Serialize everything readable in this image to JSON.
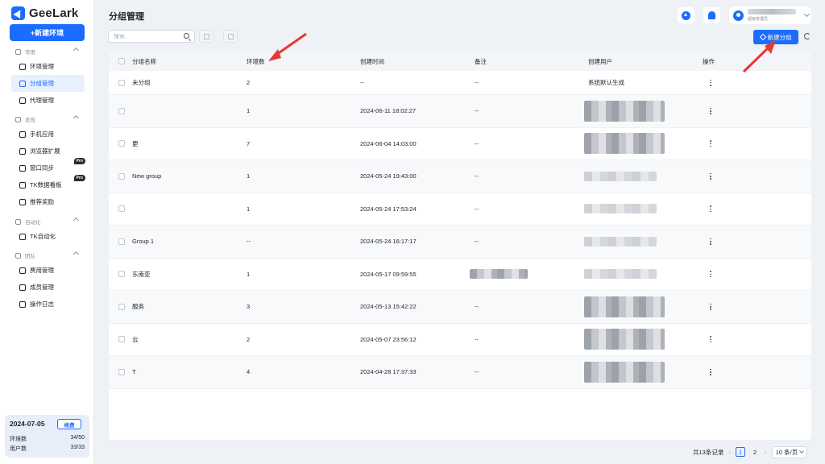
{
  "app": {
    "brand": "GeeLark"
  },
  "sidebar": {
    "new_env_label": "+新建环境",
    "groups": [
      {
        "label": "常用",
        "items": [
          "环境管理",
          "分组管理",
          "代理管理"
        ]
      },
      {
        "label": "发现",
        "items": [
          "手机应用",
          "浏览器扩展",
          "窗口同步",
          "TK数据看板",
          "推荐奖励"
        ]
      },
      {
        "label": "自动化",
        "items": [
          "TK自动化"
        ]
      },
      {
        "label": "团队",
        "items": [
          "费用管理",
          "成员管理",
          "操作日志"
        ]
      }
    ],
    "active_item": "分组管理",
    "pro_badge": "Pro",
    "stats": {
      "date": "2024-07-05",
      "renew_label": "续费",
      "env_label": "环境数",
      "env_value": "34/50",
      "user_label": "用户数",
      "user_value": "33/33"
    }
  },
  "header": {
    "title": "分组管理",
    "user_role": "超级管理员"
  },
  "toolbar": {
    "search_placeholder": "搜索",
    "new_group_label": "新建分组"
  },
  "table": {
    "columns": [
      "分组名称",
      "环境数",
      "创建时间",
      "备注",
      "创建用户",
      "操作"
    ],
    "rows": [
      {
        "name": "未分组",
        "count": "2",
        "created": "--",
        "note": "--",
        "user": "系统默认生成"
      },
      {
        "name": "​",
        "count": "1",
        "created": "2024-06-11 18:02:27",
        "note": "--",
        "user": ""
      },
      {
        "name": "更",
        "count": "7",
        "created": "2024-06-04 14:03:00",
        "note": "--",
        "user": ""
      },
      {
        "name": "New group",
        "count": "1",
        "created": "2024-05-24 19:43:00",
        "note": "--",
        "user": ""
      },
      {
        "name": "​",
        "count": "1",
        "created": "2024-05-24 17:53:24",
        "note": "--",
        "user": ""
      },
      {
        "name": "Group 1",
        "count": "--",
        "created": "2024-05-24 16:17:17",
        "note": "--",
        "user": ""
      },
      {
        "name": "东南亚",
        "count": "1",
        "created": "2024-05-17 09:59:55",
        "note": "",
        "user": ""
      },
      {
        "name": "服务",
        "count": "3",
        "created": "2024-05-13 15:42:22",
        "note": "--",
        "user": ""
      },
      {
        "name": "云",
        "count": "2",
        "created": "2024-05-07 23:56:12",
        "note": "--",
        "user": ""
      },
      {
        "name": "T",
        "count": "4",
        "created": "2024-04-28 17:37:33",
        "note": "--",
        "user": ""
      }
    ]
  },
  "pagination": {
    "total": "共13条记录",
    "pages": [
      "1",
      "2"
    ],
    "page_size": "10 条/页"
  },
  "colors": {
    "accent": "#1b6cff",
    "annotation": "#e53935"
  }
}
